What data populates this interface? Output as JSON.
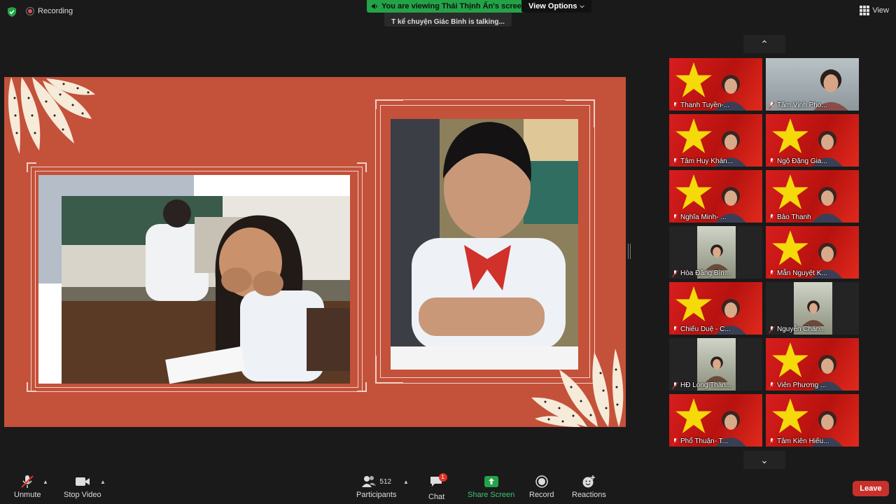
{
  "topbar": {
    "recording_label": "Recording",
    "viewing_banner": "You are viewing Thái Thịnh Ấn's screen",
    "view_options_label": "View Options",
    "talking_text": "T kể chuyện Giác Bình is talking...",
    "view_label": "View"
  },
  "gallery": {
    "participants": [
      {
        "name": "Thanh Tuyền-...",
        "bg": "flag"
      },
      {
        "name": "Tâm Vịnh Pho...",
        "bg": "room"
      },
      {
        "name": "Tâm Huy Khán...",
        "bg": "flag"
      },
      {
        "name": "Ngộ Đặng Gia...",
        "bg": "flag"
      },
      {
        "name": "Nghĩa Minh- ...",
        "bg": "flag"
      },
      {
        "name": "Bảo Thanh",
        "bg": "flag"
      },
      {
        "name": "Hòa Đặng Bìn...",
        "bg": "dark"
      },
      {
        "name": "Mẫn Nguyệt K...",
        "bg": "flag"
      },
      {
        "name": "Chiếu Duệ - C...",
        "bg": "flag"
      },
      {
        "name": "Nguyễn Chán...",
        "bg": "dark"
      },
      {
        "name": "HĐ Long Thàn...",
        "bg": "dark"
      },
      {
        "name": "Viên Phương ...",
        "bg": "flag"
      },
      {
        "name": "Phổ Thuận- T...",
        "bg": "flag"
      },
      {
        "name": "Tâm Kiên Hiếu...",
        "bg": "flag"
      }
    ]
  },
  "toolbar": {
    "unmute_label": "Unmute",
    "stop_video_label": "Stop Video",
    "participants_label": "Participants",
    "participants_count": "512",
    "chat_label": "Chat",
    "chat_badge": "1",
    "share_label": "Share Screen",
    "record_label": "Record",
    "reactions_label": "Reactions",
    "leave_label": "Leave"
  },
  "colors": {
    "slide_bg": "#c4513a",
    "accent_green": "#23a347",
    "leave_red": "#c8312b"
  }
}
